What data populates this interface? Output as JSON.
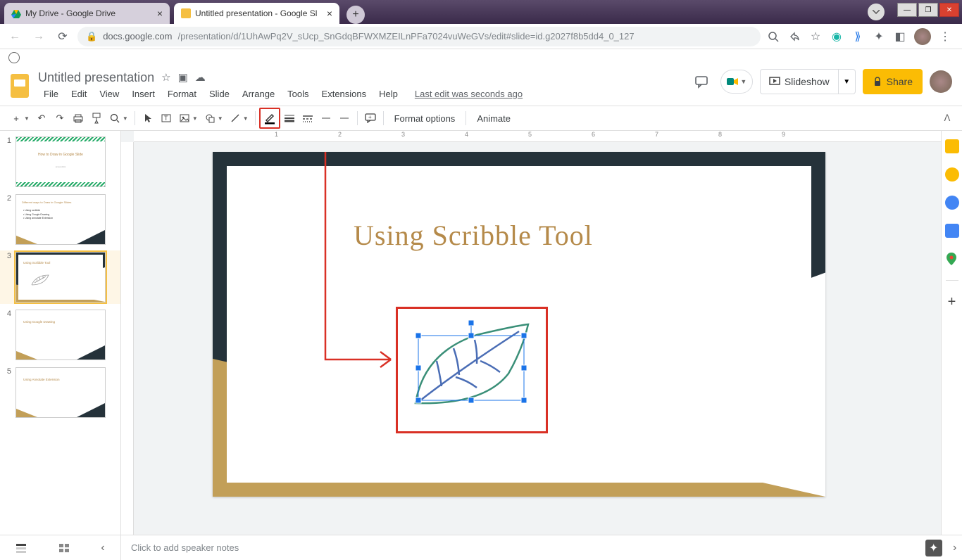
{
  "browser": {
    "tabs": [
      {
        "title": "My Drive - Google Drive",
        "favicon": "drive"
      },
      {
        "title": "Untitled presentation - Google Sl",
        "favicon": "slides"
      }
    ],
    "url_host": "docs.google.com",
    "url_path": "/presentation/d/1UhAwPq2V_sUcp_SnGdqBFWXMZEILnPFa7024vuWeGVs/edit#slide=id.g2027f8b5dd4_0_127"
  },
  "doc": {
    "title": "Untitled presentation",
    "menus": [
      "File",
      "Edit",
      "View",
      "Insert",
      "Format",
      "Slide",
      "Arrange",
      "Tools",
      "Extensions",
      "Help"
    ],
    "last_edit": "Last edit was seconds ago",
    "slideshow_label": "Slideshow",
    "share_label": "Share"
  },
  "toolbar": {
    "format_options": "Format options",
    "animate": "Animate"
  },
  "ruler_ticks": [
    "1",
    "2",
    "3",
    "4",
    "5",
    "6",
    "7",
    "8",
    "9"
  ],
  "slides": [
    {
      "num": "1",
      "title": "How to Draw in Google Slide",
      "sub": "ampoolslot"
    },
    {
      "num": "2",
      "title": "Different ways to Draw in Google Slides",
      "bullets": [
        "Using scribble",
        "Using Google Drawing",
        "Using annotate Extension"
      ]
    },
    {
      "num": "3",
      "title": "Using Scribble Tool"
    },
    {
      "num": "4",
      "title": "Using Google Drawing"
    },
    {
      "num": "5",
      "title": "Using Annotate Extension"
    }
  ],
  "current_slide": {
    "heading": "Using Scribble Tool"
  },
  "notes_placeholder": "Click to add speaker notes"
}
